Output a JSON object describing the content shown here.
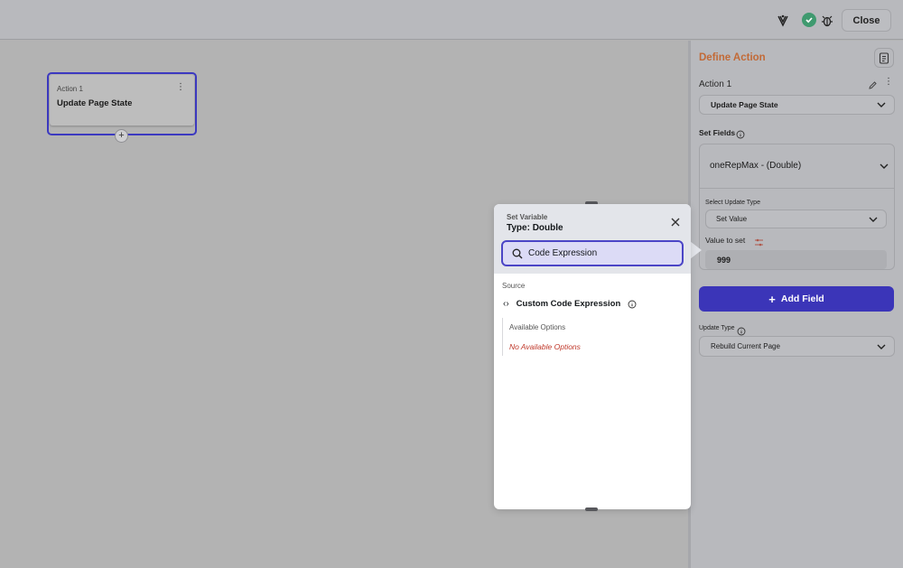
{
  "topbar": {
    "close_label": "Close",
    "icons": [
      "bug-hub-icon",
      "check-status-icon",
      "bug-icon"
    ],
    "status_color": "#3f9a6f"
  },
  "canvas": {
    "node": {
      "subtitle": "Action 1",
      "title": "Update Page State",
      "menu_icon": "kebab-menu-icon",
      "add_icon": "plus-icon"
    }
  },
  "panel": {
    "title": "Define Action",
    "title_color": "#c26a37",
    "action_name": "Action 1",
    "action_type": "Update Page State",
    "set_fields_label": "Set Fields",
    "field_name": "oneRepMax - (Double)",
    "select_update_type_label": "Select Update Type",
    "update_type_value": "Set Value",
    "value_to_set_label": "Value to set",
    "value": "999",
    "add_field_label": "Add Field",
    "update_type_label": "Update Type",
    "rebuild_value": "Rebuild Current Page",
    "accent_color": "#3b35b8"
  },
  "popup": {
    "subtitle": "Set Variable",
    "title": "Type: Double",
    "search_value": "Code Expression",
    "source_label": "Source",
    "custom_code_label": "Custom Code Expression",
    "available_options_label": "Available Options",
    "no_options_label": "No Available Options"
  }
}
